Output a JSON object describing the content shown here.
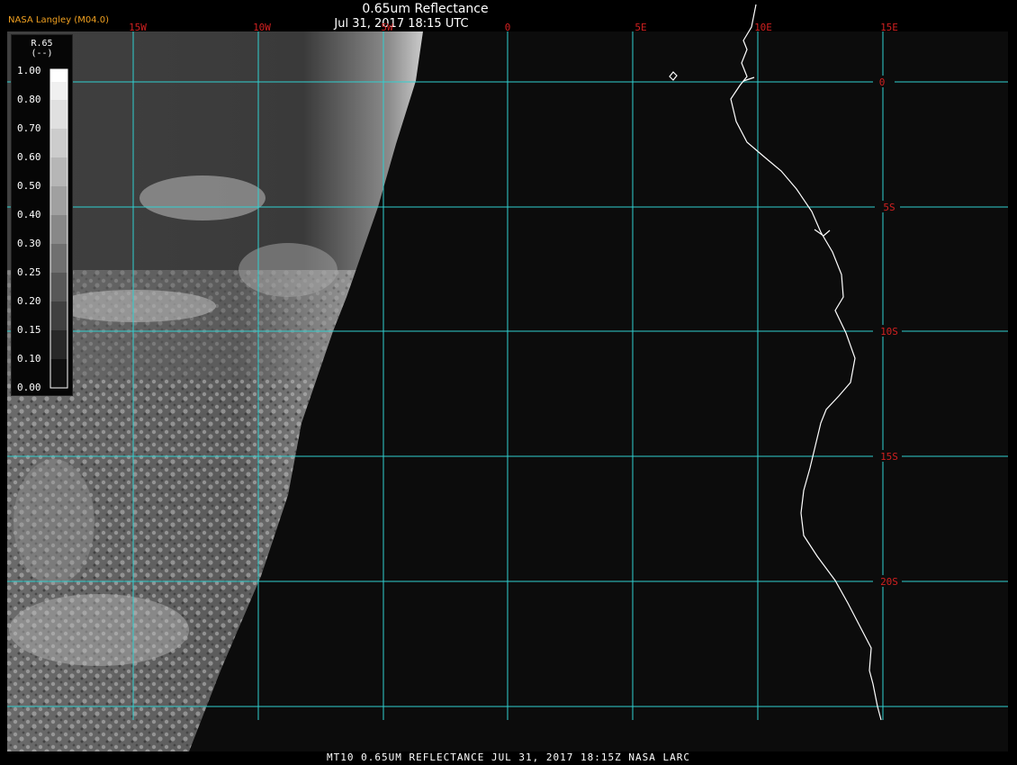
{
  "header": {
    "source_label": "NASA Langley (M04.0)",
    "title": "0.65um Reflectance",
    "datetime": "Jul 31, 2017 18:15 UTC"
  },
  "footer": {
    "caption": "MT10  0.65UM REFLECTANCE   JUL 31, 2017 18:15Z   NASA LARC"
  },
  "legend": {
    "title": "R.65",
    "units": "(--)",
    "ticks": [
      "1.00",
      "0.80",
      "0.70",
      "0.60",
      "0.50",
      "0.40",
      "0.30",
      "0.25",
      "0.20",
      "0.15",
      "0.10",
      "0.00"
    ]
  },
  "map": {
    "lon_labels": [
      "15W",
      "10W",
      "5W",
      "0",
      "5E",
      "10E",
      "15E"
    ],
    "lat_labels": [
      "0",
      "5S",
      "10S",
      "15S",
      "20S"
    ],
    "colors": {
      "grid": "#30d0d0",
      "label": "#d02020",
      "coast": "#ffffff",
      "background": "#0c0c0c"
    }
  }
}
